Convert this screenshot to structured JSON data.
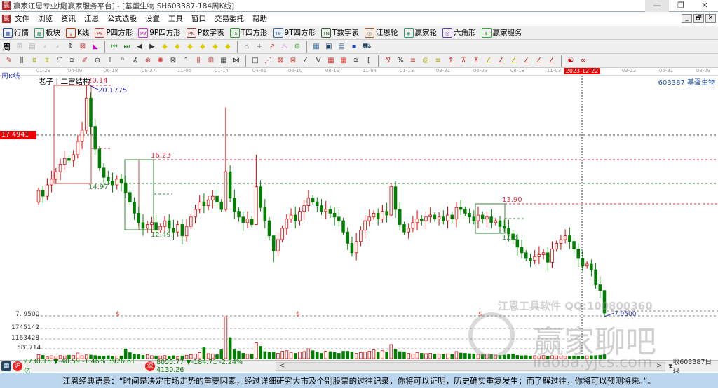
{
  "window": {
    "title": "赢家江恩专业版[赢家服务平台] - [基蛋生物  SH603387-184周K线]",
    "logo": "赢",
    "minimize": "—",
    "restore": "❐",
    "close": "✕"
  },
  "menu": [
    "文件",
    "浏览",
    "资讯",
    "江恩",
    "公式选股",
    "设置",
    "工具",
    "窗口",
    "交易委托",
    "帮助"
  ],
  "mdi_buttons": [
    "_",
    "🗗",
    "✕"
  ],
  "toolbar1": [
    {
      "label": "行情",
      "icon": "grid-icon",
      "glyph": "▦",
      "color": "#24a"
    },
    {
      "label": "板块",
      "icon": "blocks-icon",
      "glyph": "▩",
      "color": "#396"
    },
    {
      "label": "K线",
      "icon": "candles-icon",
      "glyph": "╻",
      "color": "#c30"
    },
    {
      "label": "P四方形",
      "icon": "p-square-icon",
      "glyph": "PS",
      "color": "#c33"
    },
    {
      "label": "9P四方形",
      "icon": "9p-square-icon",
      "glyph": "P9",
      "color": "#c3c"
    },
    {
      "label": "P数字表",
      "icon": "p-table-icon",
      "glyph": "PN",
      "color": "#933"
    },
    {
      "label": "T四方形",
      "icon": "t-square-icon",
      "glyph": "TS",
      "color": "#393"
    },
    {
      "label": "9T四方形",
      "icon": "9t-square-icon",
      "glyph": "T9",
      "color": "#369"
    },
    {
      "label": "T数字表",
      "icon": "t-table-icon",
      "glyph": "TN",
      "color": "#363"
    },
    {
      "label": "江恩轮",
      "icon": "gann-wheel-icon",
      "glyph": "◎",
      "color": "#a52"
    },
    {
      "label": "赢家轮",
      "icon": "winner-wheel-icon",
      "glyph": "◉",
      "color": "#396"
    },
    {
      "label": "六角形",
      "icon": "hexagon-icon",
      "glyph": "◎",
      "color": "#63c"
    },
    {
      "label": "赢家服务",
      "icon": "dollar-icon",
      "glyph": "$",
      "color": "#3a3"
    }
  ],
  "toolbar2": {
    "period": "周",
    "icons": [
      {
        "n": "zoom-icon",
        "g": "⊞",
        "c": "#aaa"
      },
      {
        "n": "page-icon",
        "g": "▤",
        "c": "#aaa"
      },
      {
        "n": "chart-small-icon",
        "g": "⸗",
        "c": "#aaa"
      },
      {
        "n": "chart-small2-icon",
        "g": "⸗",
        "c": "#aaa"
      },
      {
        "n": "cursor-updown-icon",
        "g": "⇕",
        "c": "#333"
      },
      {
        "n": "gann-fan-icon",
        "g": "⊠",
        "c": "#c33"
      },
      {
        "n": "color-fill-icon",
        "g": "◣",
        "c": "#c0c"
      },
      {
        "n": "first-icon",
        "g": "⏮",
        "c": "#282"
      },
      {
        "n": "last-icon",
        "g": "⏭",
        "c": "#282"
      },
      {
        "n": "prev-icon",
        "g": "◀",
        "c": "#333"
      },
      {
        "n": "next-icon",
        "g": "▶",
        "c": "#333"
      },
      {
        "n": "diamond1-icon",
        "g": "◆",
        "c": "#dc0"
      },
      {
        "n": "diamond2-icon",
        "g": "◆",
        "c": "#dc0"
      },
      {
        "n": "diamond3-icon",
        "g": "◆",
        "c": "#dc0"
      },
      {
        "n": "diamond4-icon",
        "g": "◆",
        "c": "#dc0"
      },
      {
        "n": "diamond5-icon",
        "g": "◆",
        "c": "#dc0"
      },
      {
        "n": "diamond6-icon",
        "g": "◆",
        "c": "#dc0"
      },
      {
        "n": "hand-icon",
        "g": "☝",
        "c": "#333"
      },
      {
        "n": "crosshair-icon",
        "g": "+",
        "c": "#333"
      },
      {
        "n": "trend-icon",
        "g": "↗",
        "c": "#c33"
      },
      {
        "n": "gift-icon",
        "g": "♨",
        "c": "#c3c"
      },
      {
        "n": "calc-icon",
        "g": "⊛",
        "c": "#393"
      },
      {
        "n": "calendar-icon",
        "g": "▦",
        "c": "#369"
      },
      {
        "n": "calculator-icon",
        "g": "▣",
        "c": "#246"
      },
      {
        "n": "notes-icon",
        "g": "▤",
        "c": "#246"
      },
      {
        "n": "save-icon",
        "g": "▪",
        "c": "#24a"
      },
      {
        "n": "truck-icon",
        "g": "⛟",
        "c": "#246"
      }
    ]
  },
  "toolbar3": {
    "icons": [
      {
        "n": "pen-icon",
        "g": "✎",
        "c": "#c33"
      },
      {
        "n": "lines-icon",
        "g": "⫼",
        "c": "#333"
      },
      {
        "n": "gold1-icon",
        "g": "⩩",
        "c": "#aa0"
      },
      {
        "n": "gold2-icon",
        "g": "⩩",
        "c": "#aa0"
      },
      {
        "n": "fib-icon",
        "g": "ℱ",
        "c": "#333"
      },
      {
        "n": "wave-icon",
        "g": "≋",
        "c": "#333"
      },
      {
        "n": "draw-icon",
        "g": "✐",
        "c": "#c33"
      },
      {
        "n": "circle-icon",
        "g": "⊖",
        "c": "#333"
      },
      {
        "n": "cycle-icon",
        "g": "⫴",
        "c": "#333"
      },
      {
        "n": "n2-icon",
        "g": "ⁿ",
        "c": "#333"
      },
      {
        "n": "angle-icon",
        "g": "∡",
        "c": "#333"
      },
      {
        "n": "target-icon",
        "g": "⊕",
        "c": "#c33"
      },
      {
        "n": "star-icon",
        "g": "✺",
        "c": "#c33"
      },
      {
        "n": "box-icon",
        "g": "⊠",
        "c": "#333"
      },
      {
        "n": "quote-icon",
        "g": "″",
        "c": "#333"
      },
      {
        "n": "red-lines-icon",
        "g": "⫼",
        "c": "#c33"
      },
      {
        "n": "red-grid-icon",
        "g": "⊞",
        "c": "#c33"
      },
      {
        "n": "hatch-icon",
        "g": "▦",
        "c": "#333"
      },
      {
        "n": "split-icon",
        "g": "⋈",
        "c": "#333"
      },
      {
        "n": "rect-icon",
        "g": "□",
        "c": "#333"
      },
      {
        "n": "fan-icon",
        "g": "⋰",
        "c": "#c33"
      },
      {
        "n": "square-fan-icon",
        "g": "⊠",
        "c": "#c33"
      },
      {
        "n": "square2-icon",
        "g": "⊠",
        "c": "#c33"
      },
      {
        "n": "angle2-icon",
        "g": "∠",
        "c": "#333"
      },
      {
        "n": "v-icon",
        "g": "V",
        "c": "#333"
      },
      {
        "n": "grid2-icon",
        "g": "▦",
        "c": "#c33"
      },
      {
        "n": "grid3-icon",
        "g": "▦",
        "c": "#c33"
      },
      {
        "n": "slash-icon",
        "g": "≋",
        "c": "#333"
      },
      {
        "n": "bracket-icon",
        "g": "[",
        "c": "#333"
      },
      {
        "n": "percent-fan-icon",
        "g": "⅋",
        "c": "#c33"
      },
      {
        "n": "percent-icon",
        "g": "%",
        "c": "#333"
      },
      {
        "n": "pct-lines-icon",
        "g": "≡",
        "c": "#c33"
      },
      {
        "n": "coin-icon",
        "g": "◎",
        "c": "#aa0"
      },
      {
        "n": "gold-lines-icon",
        "g": "≡",
        "c": "#aa0"
      },
      {
        "n": "arrow-up-icon",
        "g": "↥",
        "c": "#c33"
      },
      {
        "n": "gold-a-icon",
        "g": "⊼",
        "c": "#c33"
      },
      {
        "n": "gold-b-icon",
        "g": "⊼",
        "c": "#c33"
      },
      {
        "n": "fan2-icon",
        "g": "∠",
        "c": "#aa0"
      },
      {
        "n": "fan3-icon",
        "g": "∠",
        "c": "#c33"
      },
      {
        "n": "fan4-icon",
        "g": "∠",
        "c": "#aa0"
      },
      {
        "n": "fan5-icon",
        "g": "∠",
        "c": "#c33"
      },
      {
        "n": "fan6-icon",
        "g": "∠",
        "c": "#c33"
      },
      {
        "n": "fan7-icon",
        "g": "∠",
        "c": "#c33"
      },
      {
        "n": "yinyang-icon",
        "g": "☯",
        "c": "#c00"
      },
      {
        "n": "infinity-icon",
        "g": "∞",
        "c": "#c00"
      }
    ]
  },
  "date_axis": [
    "01-29",
    "04-09",
    "06-18",
    "08-27",
    "11-05",
    "01-14",
    "04-01",
    "06-10",
    "08-19",
    "11-04",
    "01-13",
    "03-31",
    "06-09",
    "08-18",
    "11-03",
    "2023-12-22",
    "03-22",
    "05-31",
    "08-09"
  ],
  "chart": {
    "period_label": "周K线",
    "indicator_title": "老子十二宫结构",
    "stock_label": "603387 基蛋生物",
    "cursor_price": "17.4941",
    "price_readout": "7. 9500",
    "annotations": {
      "high_box": "20.14",
      "high_point": "20.1775",
      "box2_top": "16.23",
      "box1_bottom": "14.97",
      "box2_bottom": "12.49",
      "box3_top": "13.90",
      "box3_bottom": "12.3",
      "low_point": "7.9500"
    },
    "dollar_marker": "$",
    "volume_ticks": [
      "1745142",
      "1163428",
      "581714"
    ],
    "colors": {
      "up": "#e00000",
      "down": "#008000",
      "level_red": "#dd3344",
      "level_green": "#3a8a3a",
      "note_blue": "#3333bb"
    }
  },
  "chart_data": {
    "type": "candlestick",
    "closes": [
      14.6,
      14.3,
      14.9,
      15.2,
      15.6,
      16.0,
      16.3,
      16.2,
      16.5,
      17.2,
      17.8,
      19.5,
      18.0,
      16.8,
      15.8,
      15.3,
      15.1,
      14.9,
      15.2,
      15.0,
      14.5,
      14.0,
      13.4,
      12.9,
      12.6,
      12.8,
      12.9,
      12.5,
      12.7,
      13.0,
      12.6,
      12.4,
      12.8,
      12.2,
      12.7,
      13.2,
      13.6,
      14.0,
      13.8,
      14.1,
      14.3,
      14.0,
      13.6,
      15.6,
      14.2,
      13.5,
      13.2,
      12.9,
      13.1,
      12.8,
      14.8,
      13.7,
      13.0,
      12.2,
      11.4,
      12.0,
      12.6,
      13.1,
      13.3,
      13.0,
      13.5,
      13.8,
      14.2,
      14.0,
      13.8,
      13.5,
      13.6,
      13.4,
      13.2,
      13.0,
      12.4,
      11.8,
      11.3,
      11.9,
      12.5,
      13.0,
      13.2,
      13.4,
      13.1,
      13.5,
      13.3,
      14.8,
      13.6,
      12.8,
      12.4,
      12.6,
      12.9,
      13.1,
      13.0,
      13.2,
      13.3,
      13.1,
      13.2,
      13.0,
      13.3,
      13.1,
      13.7,
      13.6,
      13.4,
      13.2,
      13.0,
      13.3,
      13.1,
      13.2,
      12.9,
      13.0,
      12.7,
      12.6,
      12.3,
      12.0,
      11.6,
      11.3,
      11.0,
      10.9,
      11.1,
      11.2,
      11.3,
      10.8,
      11.5,
      11.8,
      12.0,
      12.2,
      11.9,
      11.5,
      11.0,
      10.6,
      10.7,
      10.4,
      9.6,
      9.3,
      8.1
    ],
    "first_open": 14.0,
    "wick_overrides": {
      "11": [
        20.1775,
        17.6
      ],
      "43": [
        19.0,
        13.5
      ],
      "50": [
        16.5,
        12.8
      ],
      "54": [
        11.9,
        10.8
      ],
      "81": [
        15.0,
        13.2
      ],
      "130": [
        9.3,
        7.95
      ]
    },
    "volumes_k": [
      220,
      180,
      90,
      160,
      140,
      170,
      150,
      190,
      170,
      320,
      160,
      210,
      200,
      170,
      150,
      130,
      160,
      120,
      140,
      150,
      540,
      340,
      260,
      220,
      180,
      230,
      160,
      150,
      140,
      170,
      120,
      160,
      110,
      150,
      180,
      220,
      260,
      340,
      620,
      280,
      260,
      220,
      500,
      2400,
      1200,
      500,
      430,
      300,
      250,
      260,
      900,
      700,
      400,
      350,
      380,
      300,
      420,
      450,
      350,
      300,
      380,
      400,
      560,
      450,
      380,
      300,
      420,
      400,
      350,
      300,
      420,
      420,
      380,
      300,
      350,
      380,
      420,
      500,
      380,
      450,
      380,
      800,
      520,
      400,
      380,
      300,
      260,
      350,
      300,
      280,
      300,
      260,
      250,
      240,
      260,
      230,
      400,
      320,
      300,
      280,
      260,
      240,
      220,
      260,
      230,
      200,
      180,
      200,
      240,
      260,
      180,
      160,
      170,
      150,
      160,
      140,
      170,
      120,
      160,
      150,
      140,
      130,
      120,
      150,
      140,
      130,
      150,
      160,
      170,
      190,
      220
    ],
    "price_range": [
      7.95,
      20.1775
    ]
  },
  "status": {
    "sh_index": "2730.15 ▼-40.59 -1.46% 3926.61亿",
    "sz_index": "8055.77 ▼-184.71 -2.24% 4130.26",
    "scroll_left": "<",
    "scroll_right": ">",
    "right": "收603387日线",
    "sh_icon": "沪",
    "sz_icon": "深"
  },
  "quote": "江恩经典语录：“时间是决定市场走势的重要因素，经过详细研究大市及个别股票的过往记录，你将可以证明，历史确实重复发生；而了解过往，你将可以预测将来。”。",
  "watermark": {
    "line1": "江恩工具软件  QQ:100800360",
    "line2": "赢家聊吧",
    "line3": "liaoba.yjcs.com"
  }
}
